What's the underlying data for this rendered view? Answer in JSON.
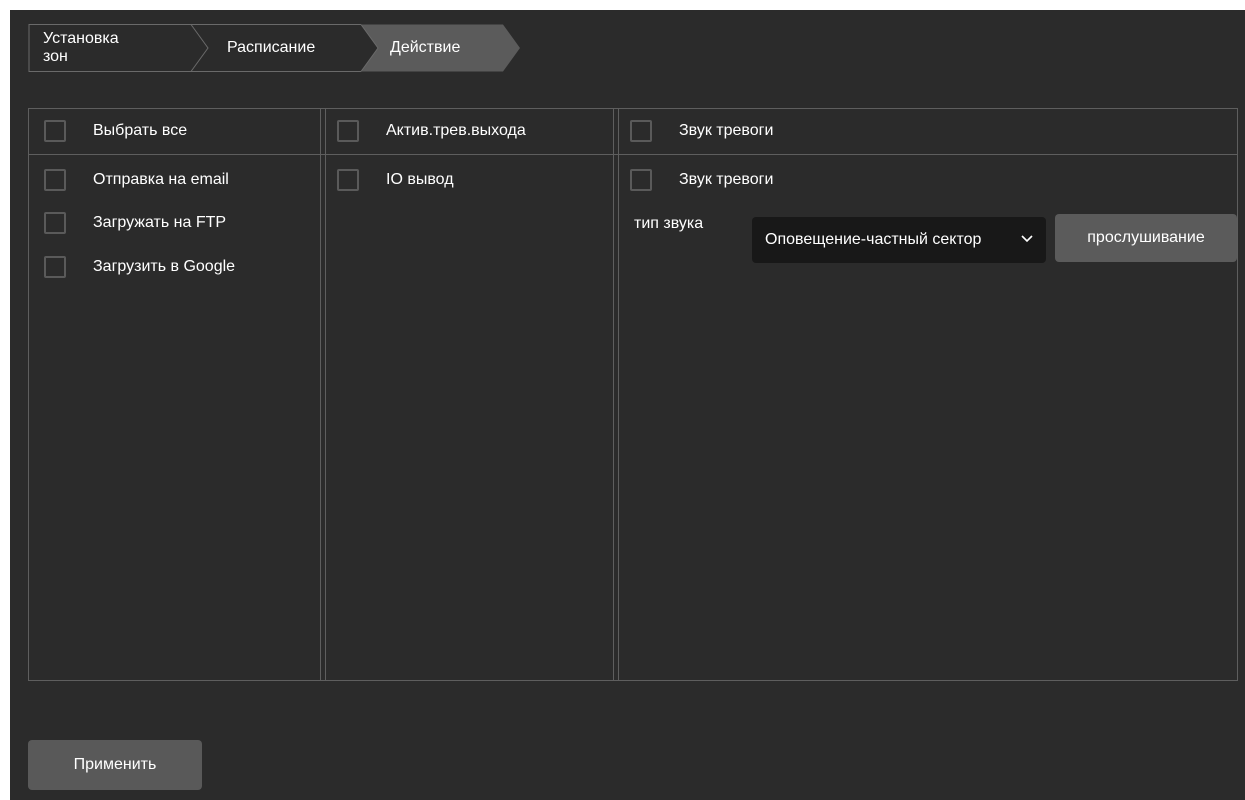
{
  "steps": [
    {
      "label": "Установка зон",
      "active": false
    },
    {
      "label": "Расписание",
      "active": false
    },
    {
      "label": "Действие",
      "active": true
    }
  ],
  "columns": {
    "col1": {
      "header": "Выбрать все",
      "items": [
        "Отправка на email",
        "Загружать на FTP",
        "Загрузить в Google"
      ]
    },
    "col2": {
      "header": "Актив.трев.выхода",
      "items": [
        "IO вывод"
      ]
    },
    "col3": {
      "header": "Звук тревоги",
      "items": [
        "Звук тревоги"
      ],
      "sound_type_label": "тип звука",
      "sound_type_value": "Оповещение-частный сектор",
      "listen_button": "прослушивание"
    }
  },
  "apply_button": "Применить",
  "colors": {
    "background": "#2b2b2b",
    "active_step": "#5b5b5b",
    "border": "#5a5a5a",
    "button": "#595959",
    "select_bg": "#181818"
  }
}
